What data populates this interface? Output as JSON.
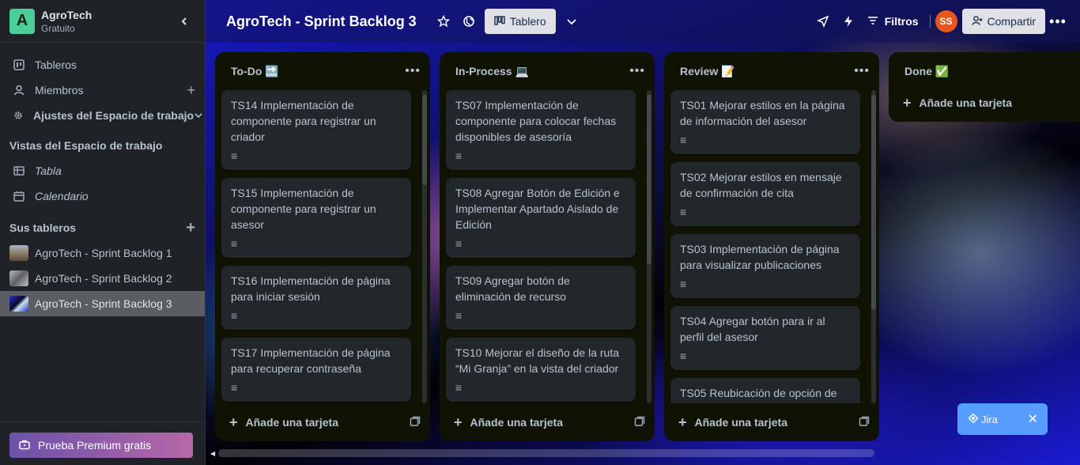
{
  "workspace": {
    "logo_letter": "A",
    "name": "AgroTech",
    "plan": "Gratuito",
    "collapse_icon": "chevron-left-icon"
  },
  "sidebar": {
    "nav": [
      {
        "label": "Tableros",
        "icon": "board-icon"
      },
      {
        "label": "Miembros",
        "icon": "person-icon",
        "extra": "+"
      },
      {
        "label": "Ajustes del Espacio de trabajo",
        "icon": "gear-icon",
        "extra": "⌄"
      }
    ],
    "views_title": "Vistas del Espacio de trabajo",
    "views": [
      {
        "label": "Tabla",
        "icon": "table-icon"
      },
      {
        "label": "Calendario",
        "icon": "calendar-icon"
      }
    ],
    "boards_title": "Sus tableros",
    "boards_add": "+",
    "boards": [
      {
        "label": "AgroTech - Sprint Backlog 1",
        "thumb_color": "#8a7a62"
      },
      {
        "label": "AgroTech - Sprint Backlog 2",
        "thumb_color": "#6d6e73"
      },
      {
        "label": "AgroTech - Sprint Backlog 3",
        "thumb_color": "#2a2ad0",
        "active": true
      }
    ],
    "premium_label": "Prueba Premium gratis"
  },
  "topbar": {
    "title": "AgroTech - Sprint Backlog 3",
    "view_label": "Tablero",
    "filters_label": "Filtros",
    "avatar_initials": "SS",
    "share_label": "Compartir"
  },
  "lists": [
    {
      "title": "To-Do 🔜",
      "cards": [
        {
          "title": "TS14 Implementación de componente para registrar un criador"
        },
        {
          "title": "TS15 Implementación de componente para registrar un asesor"
        },
        {
          "title": "TS16 Implementación de página para iniciar sesión"
        },
        {
          "title": "TS17 Implementación de página para recuperar contraseña"
        }
      ],
      "add_label": "Añade una tarjeta"
    },
    {
      "title": "In-Process 💻",
      "cards": [
        {
          "title": "TS07 Implementación de componente para colocar fechas disponibles de asesoría"
        },
        {
          "title": "TS08 Agregar Botón de Edición e Implementar Apartado Aislado de Edición"
        },
        {
          "title": "TS09 Agregar botón de eliminación de recurso"
        },
        {
          "title": "TS10 Mejorar el diseño de la ruta “Mi Granja” en la vista del criador"
        }
      ],
      "add_label": "Añade una tarjeta"
    },
    {
      "title": "Review 📝",
      "cards": [
        {
          "title": "TS01 Mejorar estilos en la página de información del asesor"
        },
        {
          "title": "TS02 Mejorar estilos en mensaje de confirmación de cita"
        },
        {
          "title": "TS03 Implementación de página para visualizar publicaciones"
        },
        {
          "title": "TS04 Agregar botón para ir al perfil del asesor"
        },
        {
          "title": "TS05 Reubicación de opción de"
        }
      ],
      "add_label": "Añade una tarjeta"
    }
  ],
  "done_list": {
    "title": "Done ✅",
    "add_label": "Añade una tarjeta"
  },
  "jira": {
    "label": "Jira",
    "close": "✕"
  },
  "colors": {
    "list_bg": "#101204",
    "card_bg": "#22272b",
    "sidebar_bg": "#1f2226",
    "accent_green": "#4bce97",
    "jira_blue": "#579dff"
  }
}
